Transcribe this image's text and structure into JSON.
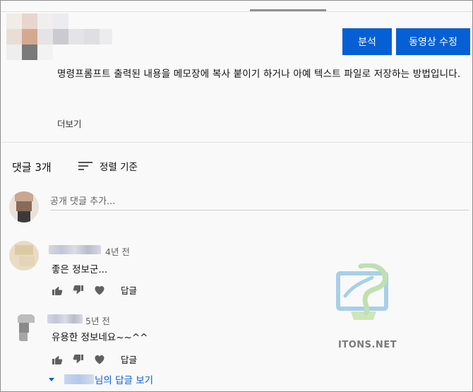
{
  "header": {
    "buttons": {
      "analyze": "분석",
      "edit_video": "동영상 수정"
    }
  },
  "description": {
    "text": "명령프롬프트 출력된 내용을 메모장에 복사 붙이기 하거나 아예 텍스트 파일로 저장하는 방법입니다.",
    "more_label": "더보기"
  },
  "comments_section": {
    "count_label": "댓글 3개",
    "sort_label": "정렬 기준",
    "add_comment_placeholder": "공개 댓글 추가..."
  },
  "comments": [
    {
      "time": "4년 전",
      "text": "좋은 정보군...",
      "reply_label": "답글"
    },
    {
      "time": "5년 전",
      "text": "유용한 정보네요~~^^",
      "reply_label": "답글",
      "view_replies_suffix": "님의 답글 보기"
    }
  ],
  "watermark": {
    "text": "ITONS.NET"
  },
  "colors": {
    "accent": "#065fd4",
    "text": "#0f0f0f",
    "secondary": "#606060",
    "background": "#f9f9f9"
  }
}
